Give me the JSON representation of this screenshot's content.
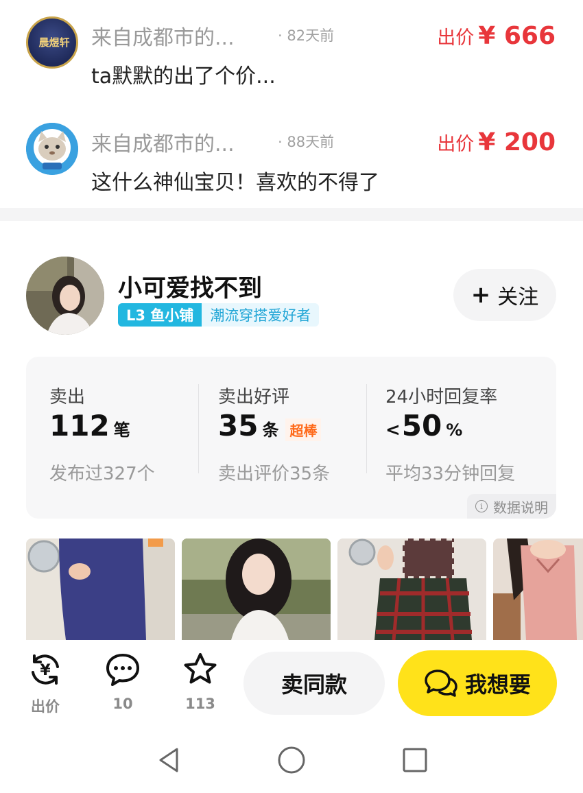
{
  "offers": [
    {
      "from": "来自成都市的...",
      "ago": "· 82天前",
      "message": "ta默默的出了个价...",
      "price_label": "出价",
      "price": "¥ 666",
      "avatar_text": "晨煜轩"
    },
    {
      "from": "来自成都市的...",
      "ago": "· 88天前",
      "message": "这什么神仙宝贝！喜欢的不得了",
      "price_label": "出价",
      "price": "¥ 200"
    }
  ],
  "seller": {
    "name": "小可爱找不到",
    "shop_level": "L3 鱼小铺",
    "tag": "潮流穿搭爱好者",
    "follow_label": "关注"
  },
  "stats": {
    "sold": {
      "title": "卖出",
      "value": "112",
      "unit": "笔",
      "sub": "发布过327个"
    },
    "reviews": {
      "title": "卖出好评",
      "value": "35",
      "unit": "条",
      "badge": "超棒",
      "sub": "卖出评价35条"
    },
    "reply": {
      "title": "24小时回复率",
      "prefix": "<",
      "value": "50",
      "unit": "%",
      "sub": "平均33分钟回复"
    },
    "data_note": "数据说明"
  },
  "bottom_bar": {
    "offer_label": "出价",
    "comments_count": "10",
    "favorites_count": "113",
    "sell_same_label": "卖同款",
    "want_label": "我想要"
  },
  "colors": {
    "price": "#e8363b",
    "accent_yellow": "#ffe21a",
    "badge_blue": "#22b7e0",
    "badge_orange": "#ff6a1a"
  }
}
